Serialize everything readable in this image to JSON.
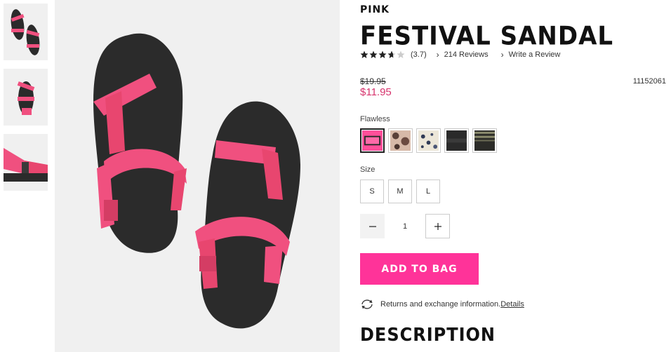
{
  "thumbnails": [
    {
      "label": "sandal-top-view"
    },
    {
      "label": "sandal-side-view"
    },
    {
      "label": "sandal-closeup-view"
    }
  ],
  "product": {
    "brand": "PINK",
    "title": "FESTIVAL SANDAL",
    "rating": {
      "value": 3.7,
      "max": 5,
      "display": "(3.7)",
      "reviews_link": "214 Reviews",
      "write_review_link": "Write a Review"
    },
    "price_original": "$19.95",
    "price_sale": "$11.95",
    "sku": "11152061",
    "color_label": "Flawless",
    "swatches": [
      {
        "name": "pink",
        "color": "#ff4f9a",
        "selected": true
      },
      {
        "name": "snake-print",
        "color": "#b08a78"
      },
      {
        "name": "tie-dye",
        "color": "#d9d2c4"
      },
      {
        "name": "black",
        "color": "#2a2a2a"
      },
      {
        "name": "olive-stripe",
        "color": "#4a4a3c"
      }
    ],
    "size_label": "Size",
    "sizes": [
      "S",
      "M",
      "L"
    ],
    "quantity": "1",
    "add_to_bag": "ADD TO BAG",
    "returns_text": "Returns and exchange information.",
    "returns_link": "Details",
    "description_heading": "DESCRIPTION"
  },
  "colors": {
    "accent_pink": "#ff3399",
    "sale_price": "#d6336c",
    "strap_pink": "#f0507f",
    "sole_black": "#2b2b2b"
  }
}
